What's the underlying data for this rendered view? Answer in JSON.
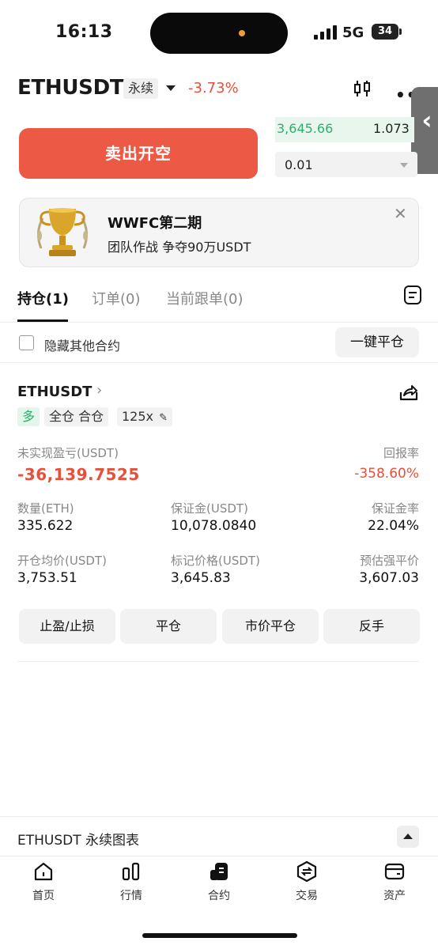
{
  "status_bar": {
    "time": "16:13",
    "network": "5G",
    "battery": "34"
  },
  "header": {
    "symbol": "ETHUSDT",
    "contract_type": "永续",
    "change_pct": "-3.73%"
  },
  "trade": {
    "sell_button": "卖出开空",
    "orderbook_price": "3,645.66",
    "orderbook_qty": "1.073",
    "step_value": "0.01"
  },
  "banner": {
    "title": "WWFC第二期",
    "subtitle": "团队作战 争夺90万USDT"
  },
  "tabs": [
    {
      "label": "持仓(1)",
      "active": true
    },
    {
      "label": "订单(0)",
      "active": false
    },
    {
      "label": "当前跟单(0)",
      "active": false
    }
  ],
  "filter": {
    "hide_others_label": "隐藏其他合约",
    "close_all_button": "一键平仓"
  },
  "position": {
    "symbol": "ETHUSDT",
    "side": "多",
    "margin_mode": "全仓 合仓",
    "leverage": "125x",
    "unrealized_pnl_label": "未实现盈亏(USDT)",
    "unrealized_pnl": "-36,139.7525",
    "roe_label": "回报率",
    "roe": "-358.60%",
    "quantity_label": "数量(ETH)",
    "quantity": "335.622",
    "margin_label": "保证金(USDT)",
    "margin": "10,078.0840",
    "margin_rate_label": "保证金率",
    "margin_rate": "22.04%",
    "entry_price_label": "开仓均价(USDT)",
    "entry_price": "3,753.51",
    "mark_price_label": "标记价格(USDT)",
    "mark_price": "3,645.83",
    "liq_price_label": "预估强平价",
    "liq_price": "3,607.03",
    "actions": [
      "止盈/止损",
      "平仓",
      "市价平仓",
      "反手"
    ]
  },
  "chart_bar": {
    "label": "ETHUSDT 永续图表"
  },
  "nav": [
    {
      "label": "首页",
      "icon": "home-icon"
    },
    {
      "label": "行情",
      "icon": "market-icon"
    },
    {
      "label": "合约",
      "icon": "futures-icon",
      "active": true
    },
    {
      "label": "交易",
      "icon": "trade-icon"
    },
    {
      "label": "资产",
      "icon": "wallet-icon"
    }
  ],
  "colors": {
    "sell": "#ec5945",
    "negative": "#e8503a",
    "positive": "#2eaf6f"
  }
}
